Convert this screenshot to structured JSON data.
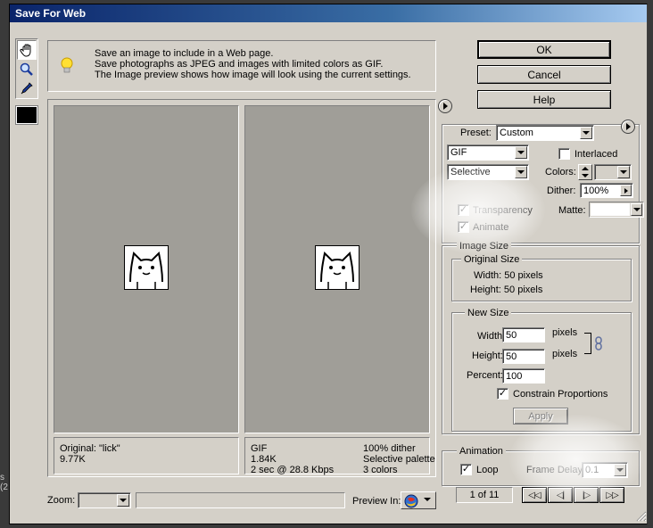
{
  "window": {
    "title": "Save For Web"
  },
  "background": {
    "left_edge_text": "s (2"
  },
  "info": {
    "line1": "Save an image to include in a Web page.",
    "line2": "Save photographs as JPEG and images with limited colors as GIF.",
    "line3": "The Image preview shows how image will look using the current settings."
  },
  "buttons": {
    "ok": "OK",
    "cancel": "Cancel",
    "help": "Help",
    "apply": "Apply"
  },
  "tools": {
    "icons": [
      "hand-icon",
      "zoom-icon",
      "eyedropper-icon"
    ],
    "swatch_color": "#000000"
  },
  "preview": {
    "original": {
      "line1": "Original: \"lick\"",
      "line2": "9.77K"
    },
    "optimized": {
      "left": [
        "GIF",
        "1.84K",
        "2 sec @ 28.8 Kbps"
      ],
      "right": [
        "100% dither",
        "Selective palette",
        "3 colors"
      ]
    }
  },
  "bottom_bar": {
    "zoom_label": "Zoom:",
    "zoom_value": "",
    "preview_in_label": "Preview In:"
  },
  "settings": {
    "preset_label": "Preset:",
    "preset_value": "Custom",
    "format_value": "GIF",
    "palette_value": "Selective",
    "interlaced_label": "Interlaced",
    "interlaced_checked": false,
    "colors_label": "Colors:",
    "colors_value": "",
    "dither_label": "Dither:",
    "dither_value": "100%",
    "transparency_label": "Transparency",
    "transparency_checked": true,
    "animate_label": "Animate",
    "animate_checked": true,
    "matte_label": "Matte:",
    "matte_color": "#ffffff"
  },
  "image_size": {
    "title": "Image Size",
    "original": {
      "title": "Original Size",
      "width_text": "Width:  50 pixels",
      "height_text": "Height:  50 pixels"
    },
    "new": {
      "title": "New Size",
      "width_label": "Width:",
      "width_value": "50",
      "height_label": "Height:",
      "height_value": "50",
      "unit": "pixels",
      "percent_label": "Percent:",
      "percent_value": "100",
      "constrain_label": "Constrain Proportions",
      "constrain_checked": true
    }
  },
  "animation": {
    "title": "Animation",
    "loop_label": "Loop",
    "loop_checked": true,
    "frame_delay_label": "Frame Delay:",
    "frame_delay_value": "0.1",
    "frame_counter": "1 of 11",
    "controls": [
      "◁◁",
      "◁|",
      "|▷",
      "▷▷"
    ]
  }
}
